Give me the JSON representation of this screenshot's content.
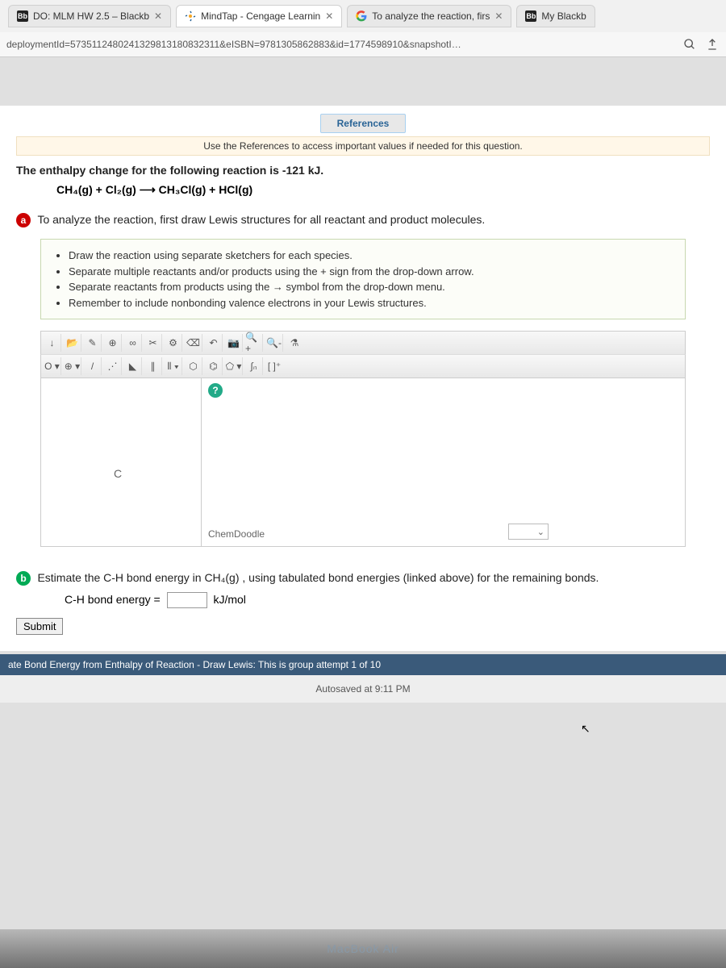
{
  "tabs": [
    {
      "label": "DO: MLM HW 2.5 – Blackb"
    },
    {
      "label": "MindTap - Cengage Learnin"
    },
    {
      "label": "To analyze the reaction, firs"
    },
    {
      "label": "My Blackb"
    }
  ],
  "url": "deploymentId=573511248024132981318083231​1&eISBN=9781305862883&id=1774598910&snapshotI…",
  "references": {
    "button": "References",
    "note": "Use the References to access important values if needed for this question."
  },
  "question": {
    "intro": "The enthalpy change for the following reaction is -121 kJ.",
    "equation": "CH₄(g) + Cl₂(g)  ⟶  CH₃Cl(g) + HCl(g)"
  },
  "part_a": {
    "label": "a",
    "text": "To analyze the reaction, first draw Lewis structures for all reactant and product molecules.",
    "instructions": [
      "Draw the reaction using separate sketchers for each species.",
      "Separate multiple reactants and/or products using the + sign from the drop-down arrow.",
      "Separate reactants from products using the → symbol from the drop-down menu.",
      "Remember to include nonbonding valence electrons in your Lewis structures."
    ],
    "atom": "C",
    "chemdoodle": "ChemDoodle"
  },
  "part_b": {
    "label": "b",
    "text": "Estimate the C-H bond energy in CH₄(g) , using tabulated bond energies (linked above) for the remaining bonds.",
    "field_label": "C-H bond energy =",
    "unit": "kJ/mol"
  },
  "submit": "Submit",
  "footer": "ate Bond Energy from Enthalpy of Reaction - Draw Lewis: This is group attempt 1 of 10",
  "autosave": "Autosaved at 9:11 PM",
  "macbook": "MacBook Air"
}
